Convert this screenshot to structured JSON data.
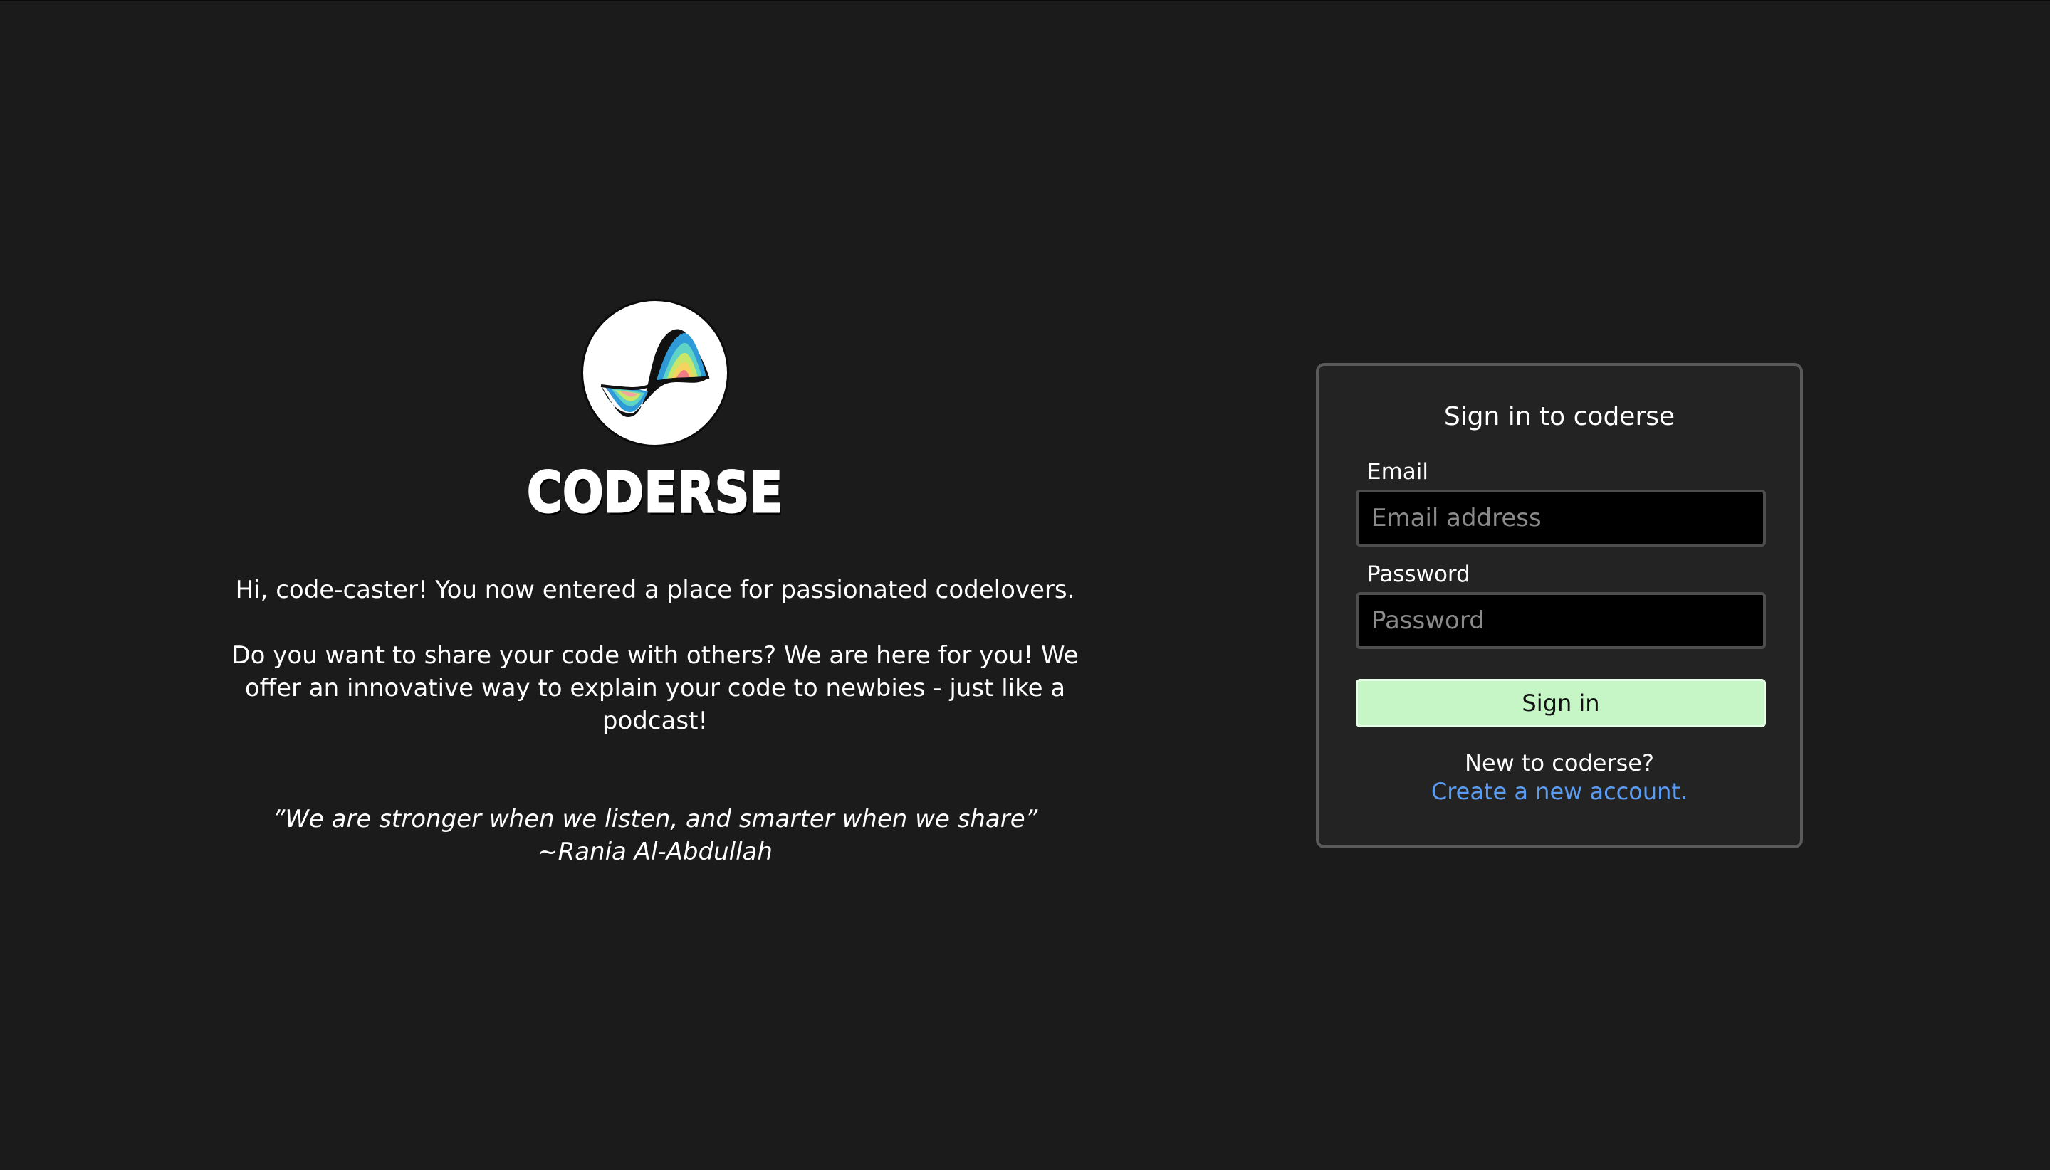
{
  "brand": {
    "name": "CODERSE",
    "logo_icon": "sine-wave-rainbow-icon",
    "logo_colors": [
      "#2f9ad8",
      "#5fd4c6",
      "#c8e66a",
      "#f4d35e",
      "#f3a6a0",
      "#f07d86"
    ]
  },
  "intro": {
    "paragraph1": "Hi, code-caster! You now entered a place for passionated codelovers.",
    "paragraph2": "Do you want to share your code with others? We are here for you! We offer an innovative way to explain your code to newbies - just like a podcast!"
  },
  "quote": {
    "text": "”We are stronger when we listen, and smarter when we share”",
    "author": "~Rania Al-Abdullah"
  },
  "signin": {
    "title": "Sign in to coderse",
    "email_label": "Email",
    "email_placeholder": "Email address",
    "password_label": "Password",
    "password_placeholder": "Password",
    "button_label": "Sign in",
    "new_user_text": "New to coderse?",
    "create_account_link": "Create a new account."
  },
  "colors": {
    "background": "#1b1b1b",
    "card_background": "#232323",
    "button_background": "#c6f6c6",
    "link": "#5a9cf2"
  }
}
